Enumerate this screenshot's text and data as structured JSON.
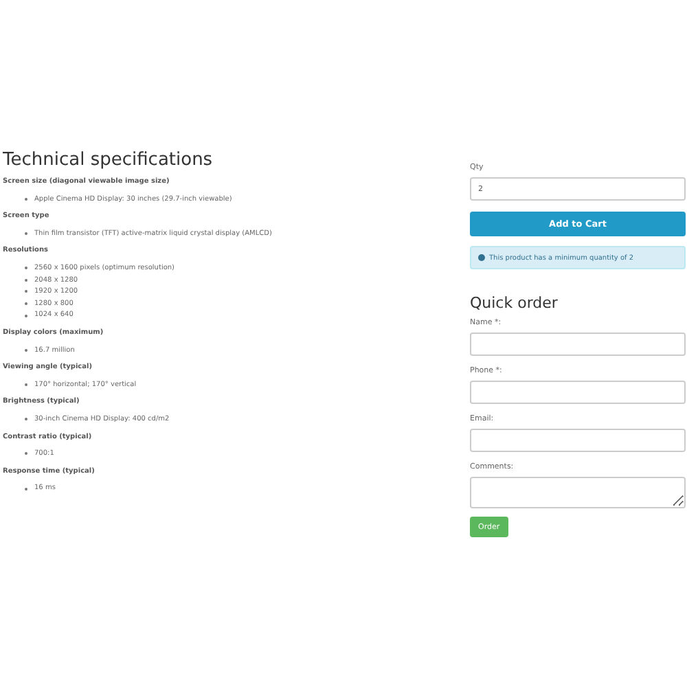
{
  "specs": {
    "title": "Technical specifications",
    "sections": [
      {
        "heading": "Screen size (diagonal viewable image size)",
        "items": [
          "Apple Cinema HD Display: 30 inches (29.7-inch viewable)"
        ]
      },
      {
        "heading": "Screen type",
        "items": [
          "Thin film transistor (TFT) active-matrix liquid crystal display (AMLCD)"
        ]
      },
      {
        "heading": "Resolutions",
        "items": [
          "2560 x 1600 pixels (optimum resolution)",
          "2048 x 1280",
          "1920 x 1200",
          "1280 x 800",
          "1024 x 640"
        ]
      },
      {
        "heading": "Display colors (maximum)",
        "items": [
          "16.7 million"
        ]
      },
      {
        "heading": "Viewing angle (typical)",
        "items": [
          "170° horizontal; 170° vertical"
        ]
      },
      {
        "heading": "Brightness (typical)",
        "items": [
          "30-inch Cinema HD Display: 400 cd/m2"
        ]
      },
      {
        "heading": "Contrast ratio (typical)",
        "items": [
          "700:1"
        ]
      },
      {
        "heading": "Response time (typical)",
        "items": [
          "16 ms"
        ]
      }
    ]
  },
  "cart": {
    "qty_label": "Qty",
    "qty_value": "2",
    "add_button": "Add to Cart",
    "notice": "This product has a minimum quantity of 2"
  },
  "quick_order": {
    "title": "Quick order",
    "fields": [
      {
        "label": "Name *:",
        "kind": "input"
      },
      {
        "label": "Phone *:",
        "kind": "input"
      },
      {
        "label": "Email:",
        "kind": "input"
      },
      {
        "label": "Comments:",
        "kind": "textarea"
      }
    ],
    "submit": "Order"
  }
}
